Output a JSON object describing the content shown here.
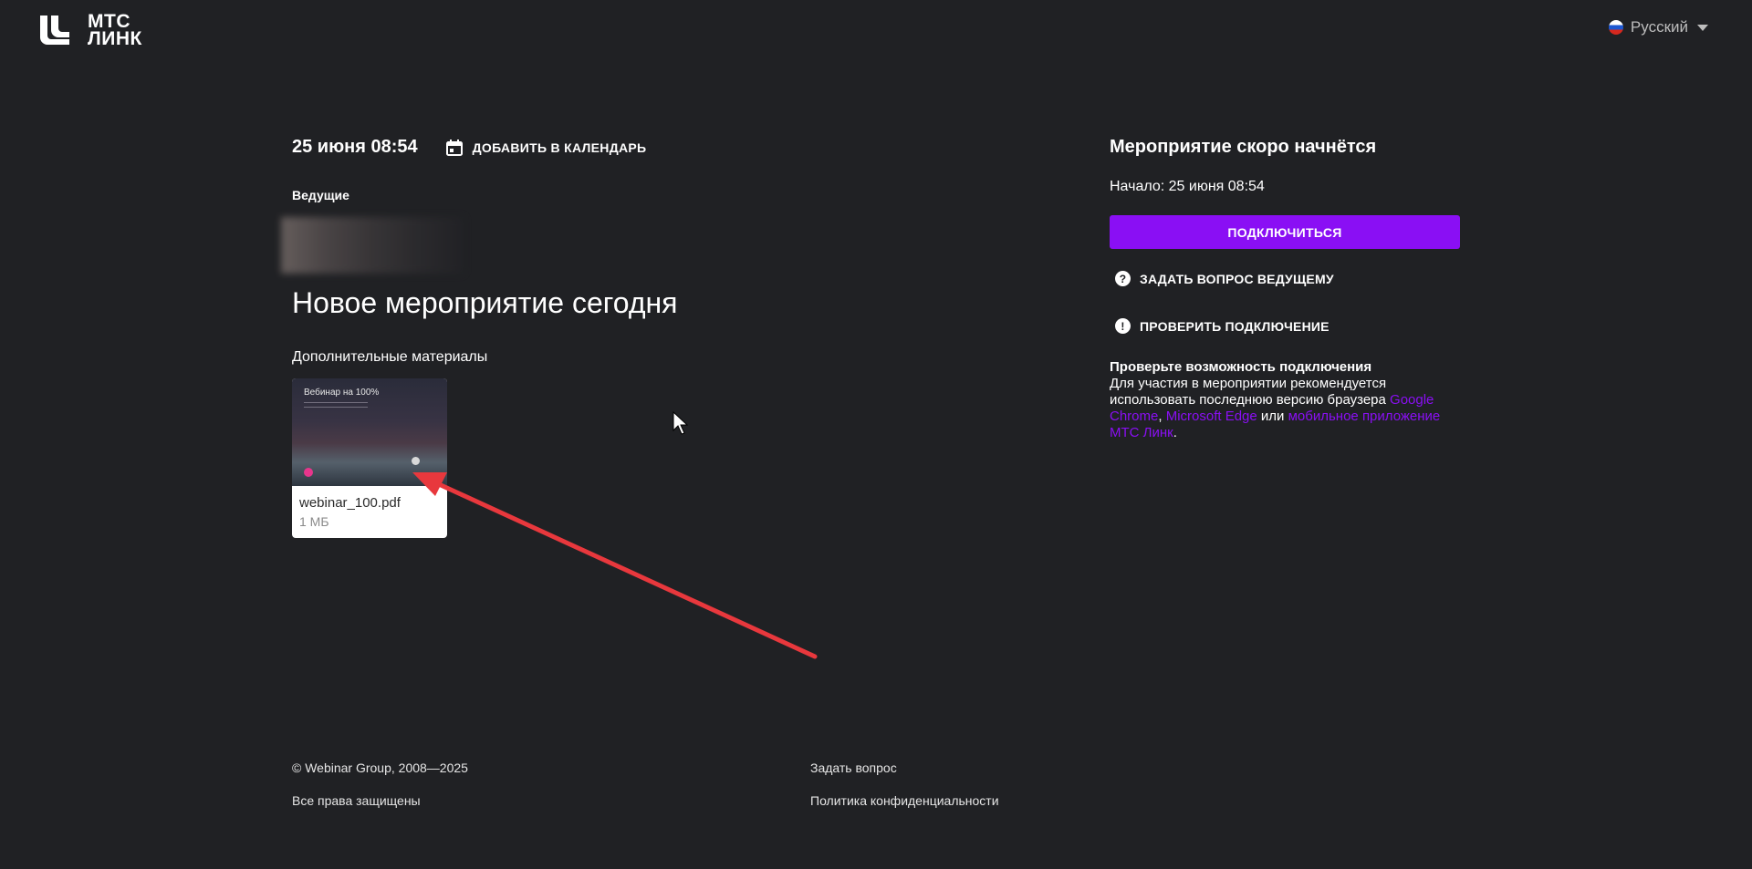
{
  "header": {
    "logo_text_line1": "МТС",
    "logo_text_line2": "ЛИНК",
    "language": "Русский"
  },
  "event": {
    "date": "25 июня 08:54",
    "add_to_calendar": "ДОБАВИТЬ В КАЛЕНДАРЬ",
    "hosts_label": "Ведущие",
    "title": "Новое мероприятие сегодня",
    "materials_label": "Дополнительные материалы",
    "file": {
      "thumbnail_title": "Вебинар на 100%",
      "name": "webinar_100.pdf",
      "size": "1 МБ"
    }
  },
  "sidebar": {
    "status_title": "Мероприятие скоро начнётся",
    "start_time": "Начало: 25 июня 08:54",
    "join_button": "ПОДКЛЮЧИТЬСЯ",
    "ask_host": "ЗАДАТЬ ВОПРОС ВЕДУЩЕМУ",
    "check_connection": "ПРОВЕРИТЬ ПОДКЛЮЧЕНИЕ",
    "tip": {
      "heading": "Проверьте возможность подключения",
      "text_before": "Для участия в мероприятии рекомендуется использовать последнюю версию браузера ",
      "link_chrome": "Google Chrome",
      "sep1": ", ",
      "link_edge": "Microsoft Edge",
      "sep2": " или ",
      "link_app": "мобильное приложение МТС Линк",
      "text_after": "."
    }
  },
  "footer": {
    "copyright": "© Webinar Group, 2008—2025",
    "rights": "Все права защищены",
    "ask_question": "Задать вопрос",
    "privacy": "Политика конфиденциальности"
  },
  "colors": {
    "background": "#202124",
    "accent": "#8a0ff4",
    "annotation_arrow": "#e8383d"
  }
}
